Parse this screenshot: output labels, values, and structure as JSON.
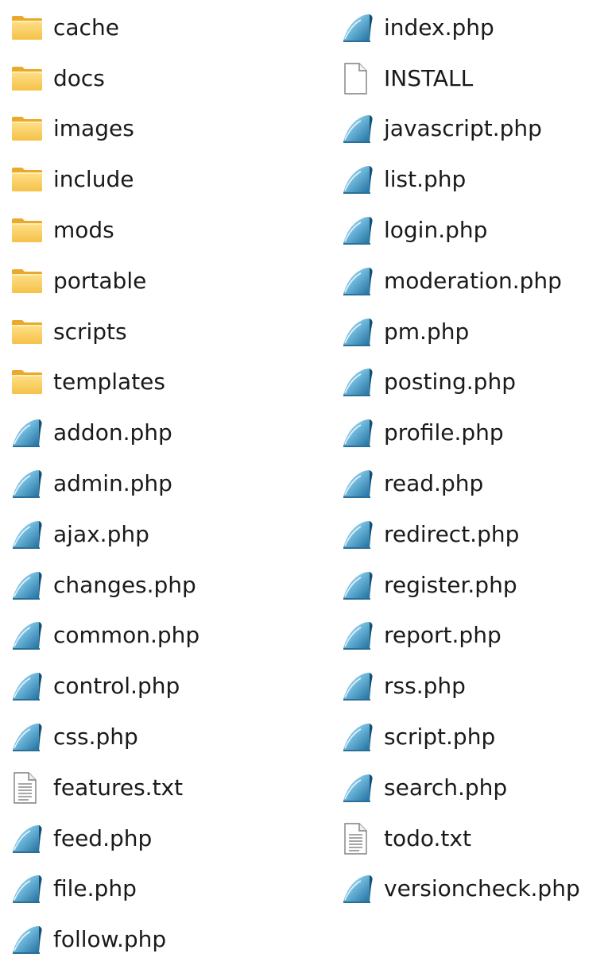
{
  "explorer": {
    "items": [
      {
        "name": "cache",
        "icon": "folder-icon"
      },
      {
        "name": "docs",
        "icon": "folder-icon"
      },
      {
        "name": "images",
        "icon": "folder-icon"
      },
      {
        "name": "include",
        "icon": "folder-icon"
      },
      {
        "name": "mods",
        "icon": "folder-icon"
      },
      {
        "name": "portable",
        "icon": "folder-icon"
      },
      {
        "name": "scripts",
        "icon": "folder-icon"
      },
      {
        "name": "templates",
        "icon": "folder-icon"
      },
      {
        "name": "addon.php",
        "icon": "php-file-icon"
      },
      {
        "name": "admin.php",
        "icon": "php-file-icon"
      },
      {
        "name": "ajax.php",
        "icon": "php-file-icon"
      },
      {
        "name": "changes.php",
        "icon": "php-file-icon"
      },
      {
        "name": "common.php",
        "icon": "php-file-icon"
      },
      {
        "name": "control.php",
        "icon": "php-file-icon"
      },
      {
        "name": "css.php",
        "icon": "php-file-icon"
      },
      {
        "name": "features.txt",
        "icon": "text-file-icon"
      },
      {
        "name": "feed.php",
        "icon": "php-file-icon"
      },
      {
        "name": "file.php",
        "icon": "php-file-icon"
      },
      {
        "name": "follow.php",
        "icon": "php-file-icon"
      },
      {
        "name": "index.php",
        "icon": "php-file-icon"
      },
      {
        "name": "INSTALL",
        "icon": "blank-file-icon"
      },
      {
        "name": "javascript.php",
        "icon": "php-file-icon"
      },
      {
        "name": "list.php",
        "icon": "php-file-icon"
      },
      {
        "name": "login.php",
        "icon": "php-file-icon"
      },
      {
        "name": "moderation.php",
        "icon": "php-file-icon"
      },
      {
        "name": "pm.php",
        "icon": "php-file-icon"
      },
      {
        "name": "posting.php",
        "icon": "php-file-icon"
      },
      {
        "name": "profile.php",
        "icon": "php-file-icon"
      },
      {
        "name": "read.php",
        "icon": "php-file-icon"
      },
      {
        "name": "redirect.php",
        "icon": "php-file-icon"
      },
      {
        "name": "register.php",
        "icon": "php-file-icon"
      },
      {
        "name": "report.php",
        "icon": "php-file-icon"
      },
      {
        "name": "rss.php",
        "icon": "php-file-icon"
      },
      {
        "name": "script.php",
        "icon": "php-file-icon"
      },
      {
        "name": "search.php",
        "icon": "php-file-icon"
      },
      {
        "name": "todo.txt",
        "icon": "text-file-icon"
      },
      {
        "name": "versioncheck.php",
        "icon": "php-file-icon"
      }
    ]
  }
}
